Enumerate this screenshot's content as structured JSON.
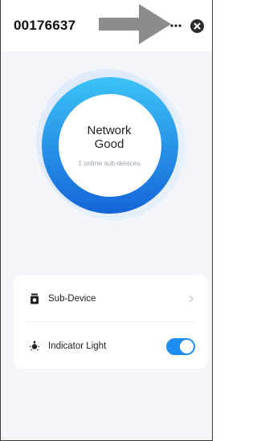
{
  "header": {
    "title": "00176637",
    "more_icon": "more-horizontal-icon",
    "close_icon": "close-circle-icon"
  },
  "status": {
    "line1": "Network",
    "line2": "Good",
    "subtext": "1 online sub-devices"
  },
  "settings": {
    "items": [
      {
        "label": "Sub-Device",
        "icon": "sub-device-icon",
        "control": "chevron-right-icon"
      },
      {
        "label": "Indicator Light",
        "icon": "light-bulb-icon",
        "control": "toggle",
        "on": true
      }
    ]
  },
  "colors": {
    "accent": "#1e88e5",
    "ring_outer": "#1f6fd6",
    "ring_inner": "#39b9f5",
    "toggle_on": "#1f8df0",
    "arrow": "#8c8c8c"
  }
}
